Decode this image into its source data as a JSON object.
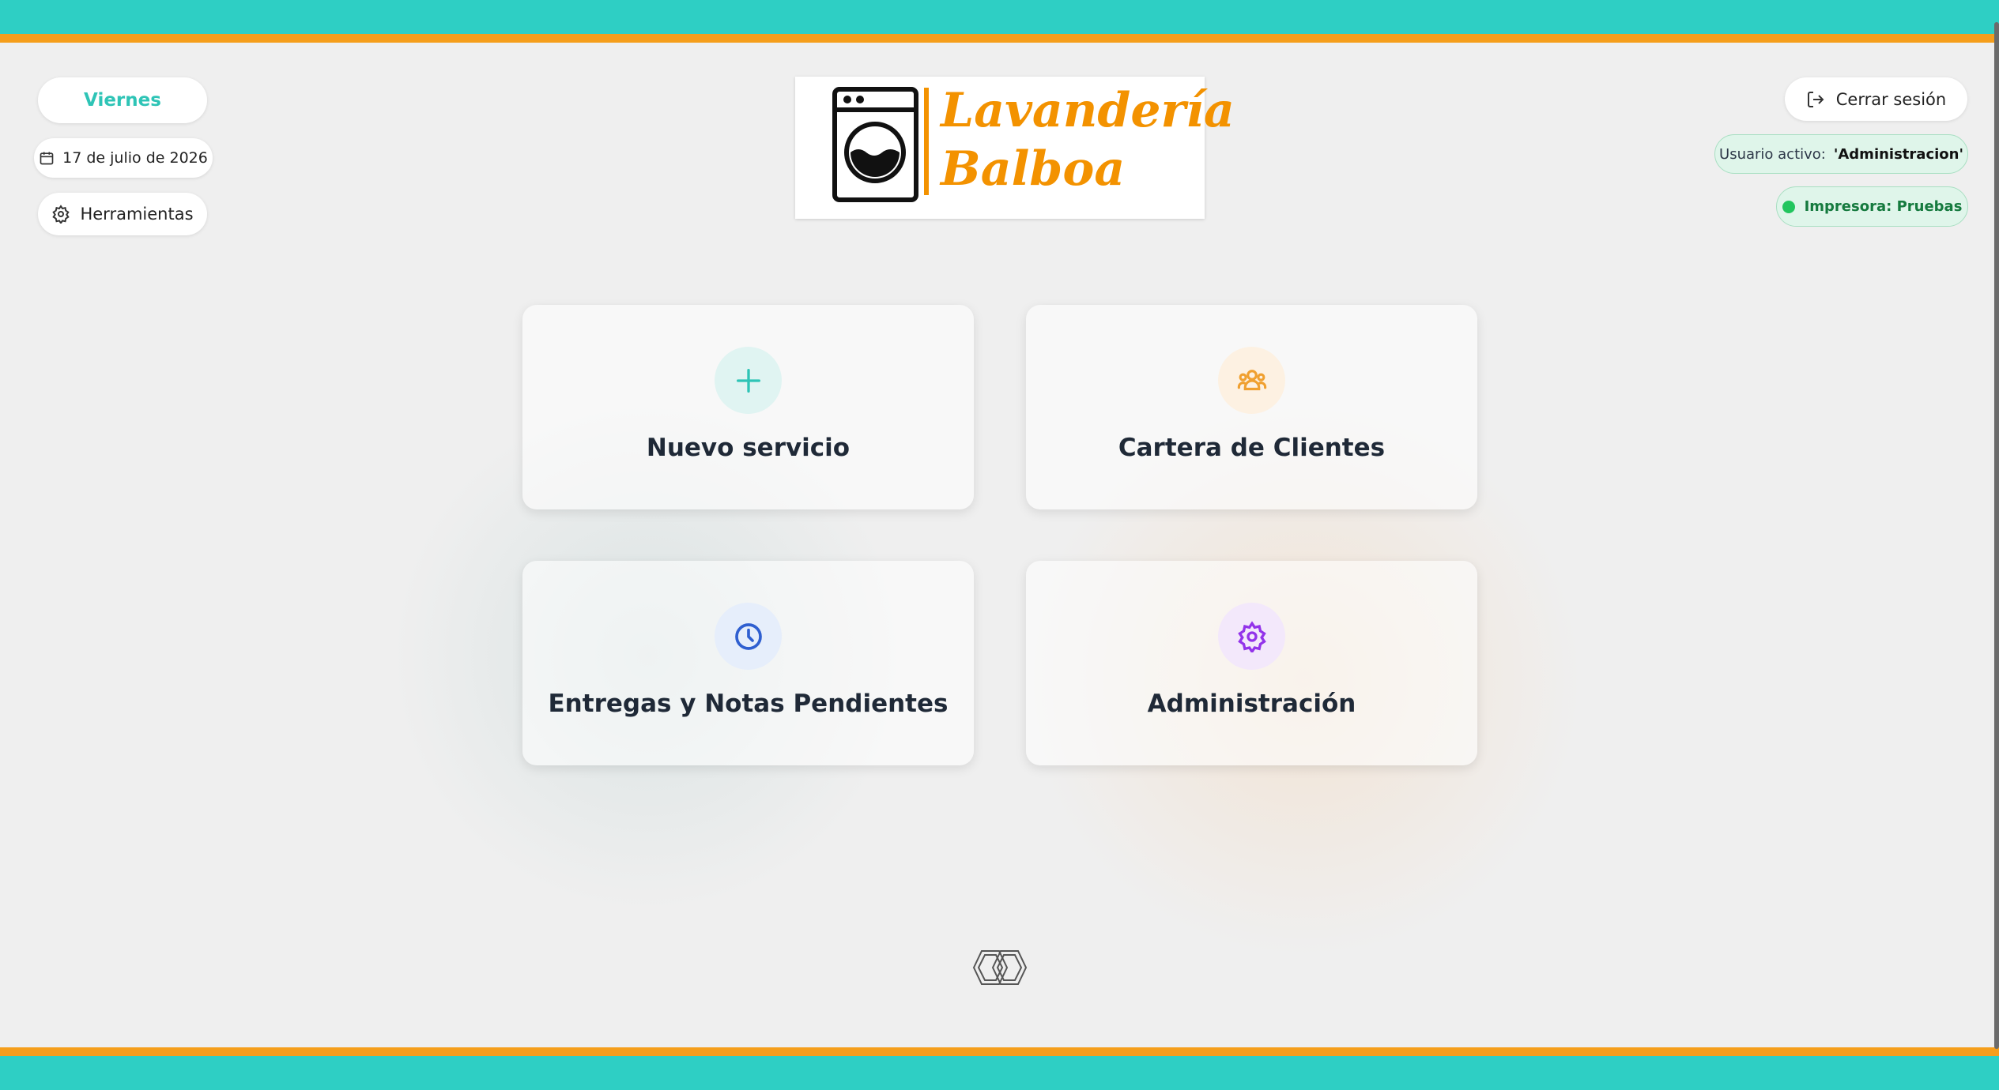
{
  "header": {
    "day": "Viernes",
    "date": "17 de julio de 2026",
    "tools_label": "Herramientas",
    "logout_label": "Cerrar sesión",
    "user_label": "Usuario activo:",
    "user_value": "'Administracion'",
    "printer_label": "Impresora: Pruebas"
  },
  "logo": {
    "line1": "Lavandería",
    "line2": "Balboa"
  },
  "menu": [
    {
      "label": "Nuevo servicio",
      "icon": "plus-icon",
      "color": "#2ec4b6"
    },
    {
      "label": "Cartera de Clientes",
      "icon": "users-icon",
      "color": "#f0a030"
    },
    {
      "label": "Entregas y Notas Pendientes",
      "icon": "clock-icon",
      "color": "#2f5fd0"
    },
    {
      "label": "Administración",
      "icon": "gear-icon",
      "color": "#9333ea"
    }
  ],
  "colors": {
    "teal": "#2ecfc4",
    "orange": "#f59e1b",
    "status_green": "#22c55e"
  }
}
